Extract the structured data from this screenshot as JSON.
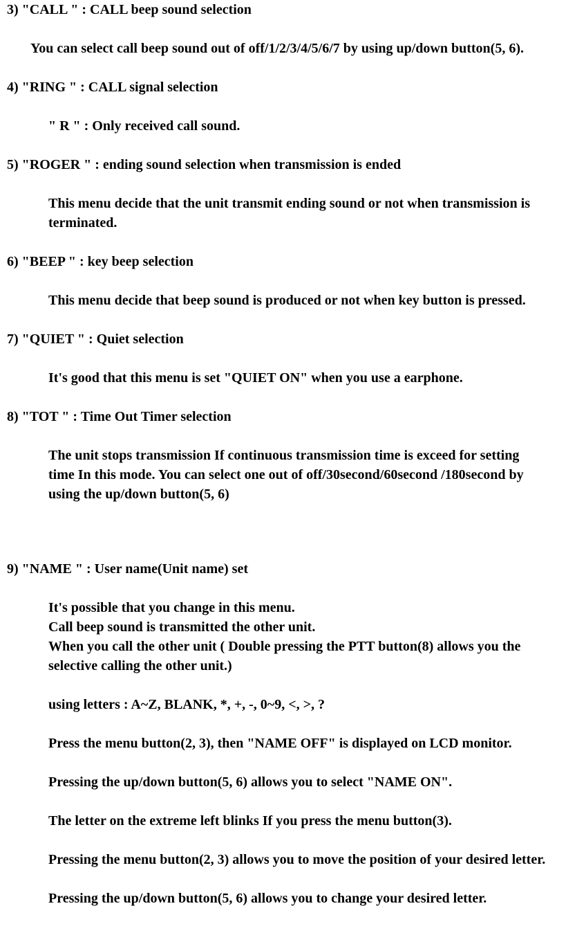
{
  "items": [
    {
      "num": "3)",
      "title": "\"CALL     \"  : CALL beep sound selection",
      "body": [
        {
          "text": "You can select call beep sound out of off/1/2/3/4/5/6/7 by using up/down button(5, 6).",
          "indent": "body-text-indent"
        }
      ]
    },
    {
      "num": "4)",
      "title": "\"RING     \"  : CALL signal selection",
      "body": [
        {
          "text": "\" R \" : Only received call sound.",
          "indent": "body-text"
        }
      ]
    },
    {
      "num": "5)",
      "title": "\"ROGER   \"  : ending sound selection when transmission is ended",
      "body": [
        {
          "text": "This menu decide that the unit transmit ending sound or not when transmission is terminated.",
          "indent": "body-text"
        }
      ]
    },
    {
      "num": "6)",
      "title": "\"BEEP     \"  : key beep selection",
      "body": [
        {
          "text": "This menu decide that beep sound is produced or not when key button is pressed.",
          "indent": "body-text"
        }
      ]
    },
    {
      "num": "7)",
      "title": "\"QUIET   \"  : Quiet selection",
      "body": [
        {
          "text": "It's good that this menu is set \"QUIET ON\" when you use a earphone.",
          "indent": "body-text"
        }
      ]
    },
    {
      "num": "8)",
      "title": "\"TOT       \"  : Time Out Timer selection",
      "body": [
        {
          "text": "The unit stops transmission If continuous transmission time is exceed for setting time In this mode. You can select one out of off/30second/60second /180second by using the up/down button(5, 6)",
          "indent": "body-text"
        }
      ],
      "gapAfter": "gap-large"
    },
    {
      "num": "9)",
      "title": "\"NAME     \"  : User name(Unit name) set",
      "body": [
        {
          "text": "It's possible that you change in this menu.",
          "indent": "body-text",
          "nogap": true
        },
        {
          "text": "Call beep sound is transmitted the other unit.",
          "indent": "body-text",
          "nogap": true
        },
        {
          "text": "When you call the other unit ( Double pressing  the PTT button(8) allows you the selective calling the other unit.)",
          "indent": "body-text"
        },
        {
          "text": "using letters :  A~Z, BLANK, *, +, -, 0~9, <, >, ?",
          "indent": "body-text"
        },
        {
          "text": "Press the menu button(2, 3), then \"NAME OFF\" is displayed on LCD monitor.",
          "indent": "body-text"
        },
        {
          "text": "Pressing the up/down button(5, 6) allows you to select \"NAME   ON\".",
          "indent": "body-text"
        },
        {
          "text": "The letter on the extreme left blinks If you press the menu button(3).",
          "indent": "body-text"
        },
        {
          "text": "Pressing the menu button(2, 3) allows you to move the position of your desired letter.",
          "indent": "body-text"
        },
        {
          "text": "Pressing the up/down button(5, 6) allows you to change your desired letter.",
          "indent": "body-text"
        }
      ]
    }
  ]
}
